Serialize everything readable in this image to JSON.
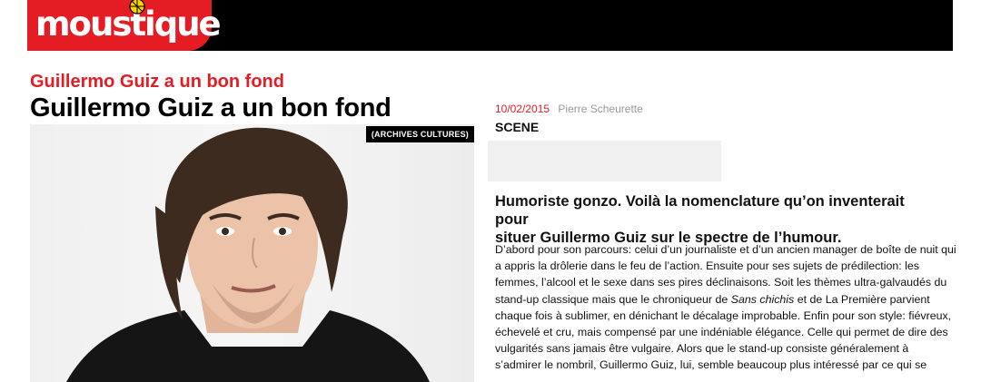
{
  "header": {
    "logo_text": "moustique"
  },
  "article": {
    "kicker": "Guillermo Guiz a un bon fond",
    "title": "Guillermo Guiz a un bon fond",
    "photo_badge": "(ARCHIVES CULTURES)",
    "date": "10/02/2015",
    "author": "Pierre Scheurette",
    "section": "SCENE",
    "lead": [
      "Humoriste gonzo. Voilà la nomenclature qu’on inventerait pour",
      "situer Guillermo Guiz sur le spectre de l’humour."
    ],
    "body_lines": [
      "D’abord pour son parcours: celui d’un journaliste et d’un ancien manager de boîte de nuit qui",
      "a appris la drôlerie dans le feu de l’action. Ensuite pour ses sujets de prédilection: les",
      "femmes, l’alcool et le sexe dans ses pires déclinaisons. Soit les thèmes ultra-galvaudés du",
      "stand-up classique mais que le chroniqueur de",
      "Sans chichis",
      "et de La Première parvient",
      "chaque fois à sublimer, en dénichant le décalage improbable. Enfin pour son style: fiévreux,",
      "échevelé et cru, mais compensé par une indéniable élégance. Celle qui permet de dire des",
      "vulgarités sans jamais être vulgaire. Alors que le stand-up consiste généralement à",
      "s’admirer le nombril, Guillermo Guiz, lui, semble beaucoup plus intéressé par ce qui se"
    ]
  }
}
